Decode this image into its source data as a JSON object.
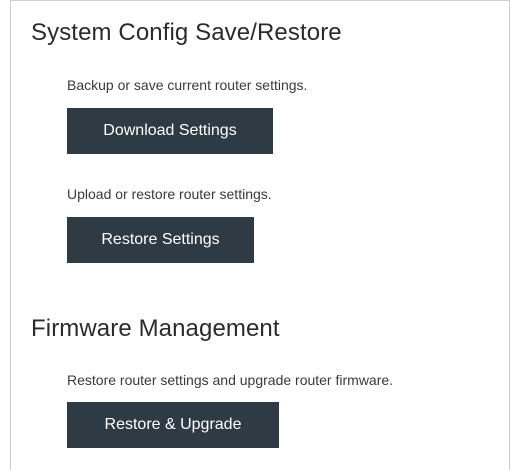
{
  "system_config": {
    "title": "System Config Save/Restore",
    "backup_description": "Backup or save current router settings.",
    "download_button": "Download Settings",
    "restore_description": "Upload or restore router settings.",
    "restore_button": "Restore Settings"
  },
  "firmware": {
    "title": "Firmware Management",
    "description": "Restore router settings and upgrade router firmware.",
    "upgrade_button": "Restore & Upgrade"
  },
  "colors": {
    "button_bg": "#2e3b44",
    "button_text": "#ffffff",
    "border": "#cfcfcf"
  }
}
